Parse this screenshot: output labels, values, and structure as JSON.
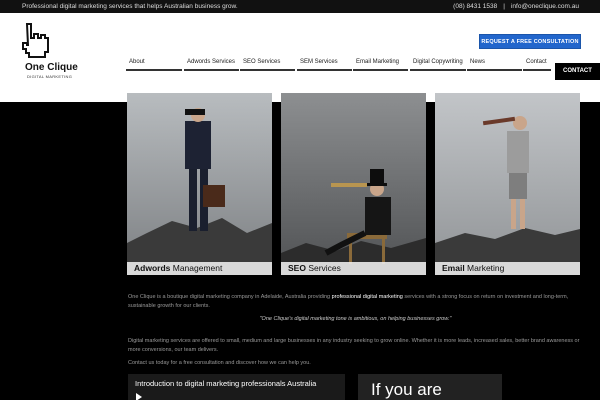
{
  "topbar": {
    "tagline": "Professional digital marketing services that helps Australian business grow.",
    "phone": "(08) 8431 1538",
    "separator": "|",
    "email": "info@oneclique.com.au"
  },
  "logo": {
    "name": "One Clique",
    "subtitle": "DIGITAL MARKETING"
  },
  "cta": {
    "label": "REQUEST A FREE CONSULTATION"
  },
  "nav": {
    "items": [
      "About",
      "Adwords Services",
      "SEO Services",
      "SEM Services",
      "Email Marketing",
      "Digital Copywriting",
      "News",
      "Contact"
    ],
    "contact_button": "CONTACT"
  },
  "cards": [
    {
      "bold": "Adwords",
      "rest": " Management"
    },
    {
      "bold": "SEO",
      "rest": " Services"
    },
    {
      "bold": "Email",
      "rest": " Marketing"
    }
  ],
  "body": {
    "intro_pre": "One Clique is a boutique digital marketing company in Adelaide, Australia providing ",
    "intro_highlight": "professional digital marketing",
    "intro_post": " services with a strong focus on return on investment and long-term, sustainable growth for our clients.",
    "quote": "\"One Clique's digital marketing tone is ambitious, on helping businesses grow.\"",
    "para2": "Digital marketing services are offered to small, medium and large businesses in any industry seeking to grow online. Whether it is more leads, increased sales, better brand awareness or more conversions, our team delivers.",
    "para3": "Contact us today for a free consultation and discover how we can help you."
  },
  "video": {
    "title": "Introduction to digital marketing professionals Australia"
  },
  "promo": {
    "text": "If you are"
  },
  "colors": {
    "cta": "#2266cc",
    "header_bg": "#ffffff",
    "page_bg": "#000000"
  }
}
